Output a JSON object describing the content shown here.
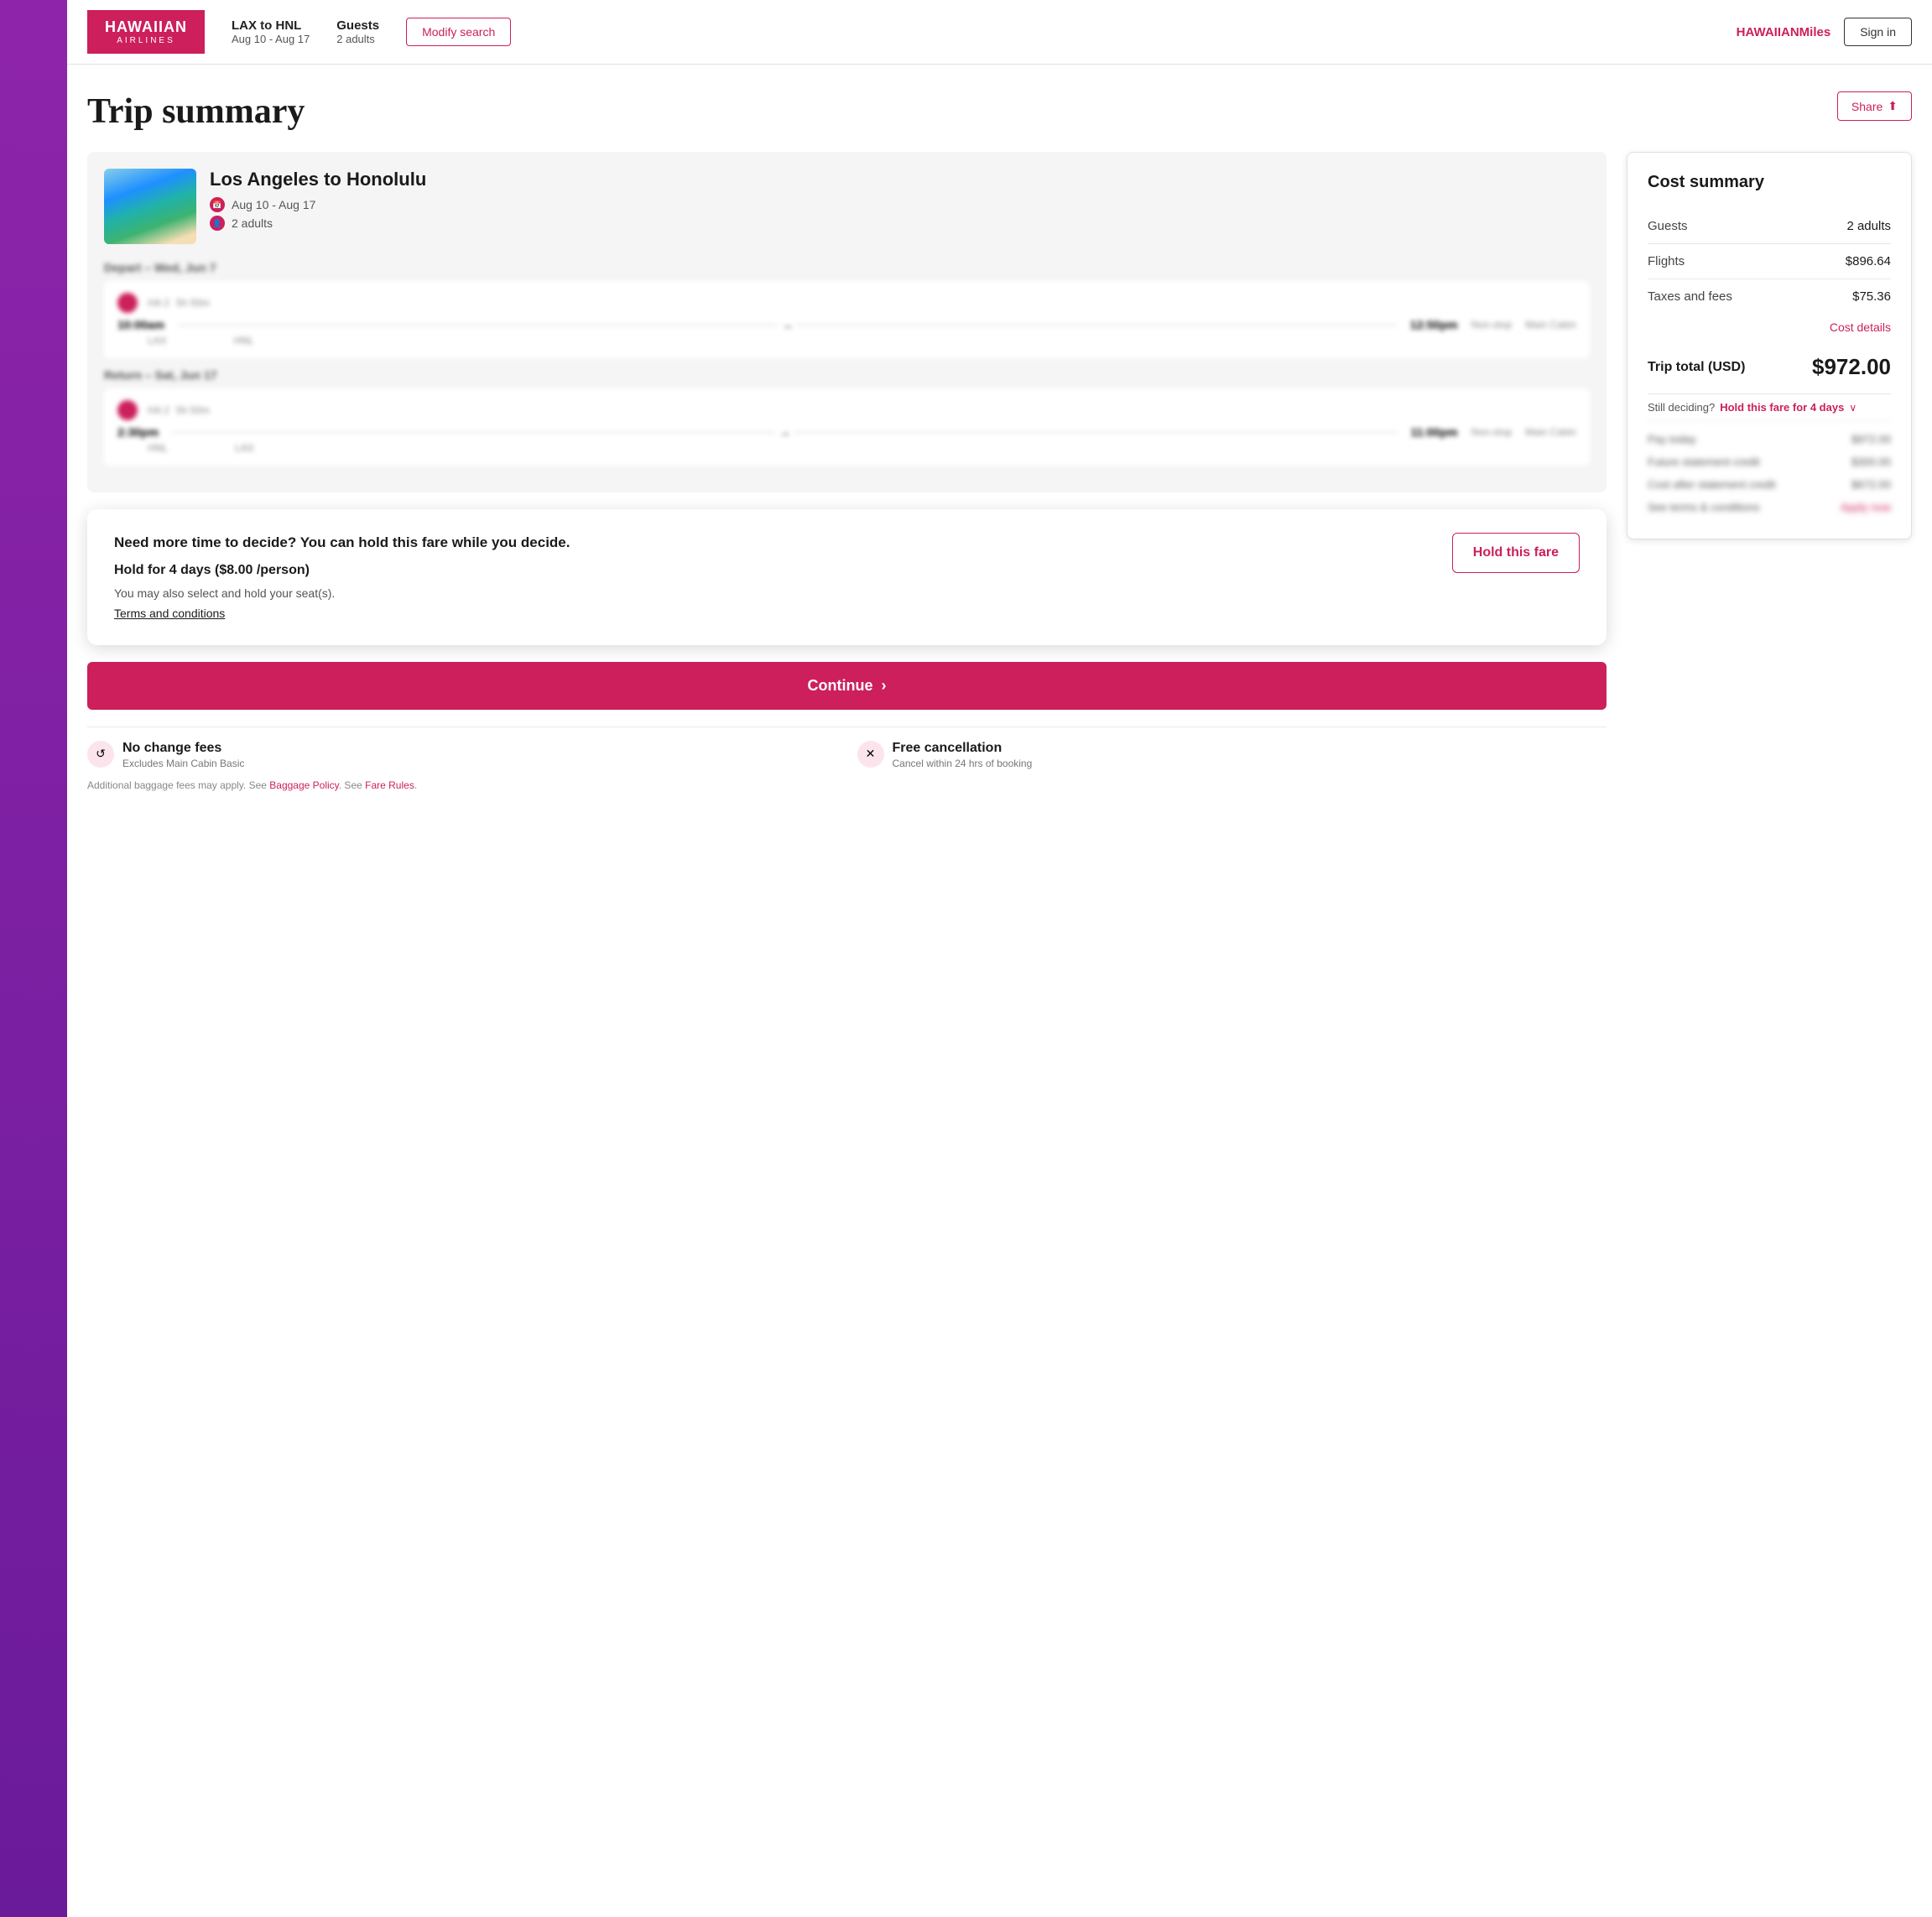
{
  "header": {
    "logo_main": "HAWAIIAN",
    "logo_sub": "AIRLINES",
    "route": "LAX to HNL",
    "dates": "Aug 10 - Aug 17",
    "guests_label": "Guests",
    "guests_value": "2 adults",
    "modify_btn": "Modify search",
    "miles_prefix": "HAWAIIAN",
    "miles_suffix": "Miles",
    "signin_btn": "Sign in"
  },
  "page": {
    "title": "Trip summary",
    "share_btn": "Share"
  },
  "trip_card": {
    "route_title": "Los Angeles to Honolulu",
    "dates": "Aug 10 - Aug 17",
    "guests": "2 adults",
    "depart_header": "Depart – Wed, Jun 7",
    "depart_flight": {
      "flight_num": "HA 2",
      "duration": "5h 50m",
      "depart_time": "10:00am",
      "arrive_time": "12:50pm",
      "stop": "Non-stop",
      "cabin": "Main Cabin",
      "from_airport": "LAX",
      "to_airport": "HNL"
    },
    "return_header": "Return – Sat, Jun 17",
    "return_flight": {
      "flight_num": "HA 2",
      "duration": "5h 50m",
      "depart_time": "2:30pm",
      "arrive_time": "11:00pm",
      "stop": "Non-stop",
      "cabin": "Main Cabin",
      "from_airport": "HNL",
      "to_airport": "LAX"
    }
  },
  "cost_summary": {
    "title": "Cost summary",
    "guests_label": "Guests",
    "guests_value": "2 adults",
    "flights_label": "Flights",
    "flights_value": "$896.64",
    "taxes_label": "Taxes and fees",
    "taxes_value": "$75.36",
    "cost_details_link": "Cost details",
    "total_label": "Trip total (USD)",
    "total_value": "$972.00",
    "deciding_text": "Still deciding?",
    "hold_fare_link": "Hold this fare for 4 days",
    "breakdown": {
      "pay_today_label": "Pay today",
      "pay_today_value": "$972.00",
      "future_credit_label": "Future statement credit",
      "future_credit_value": "$300.00",
      "after_credit_label": "Cost after statement credit",
      "after_credit_value": "$672.00",
      "terms_label": "See terms & conditions",
      "apply_now": "Apply now"
    }
  },
  "hold_popup": {
    "heading": "Need more time to decide? You can hold this fare while you decide.",
    "duration": "Hold for 4 days ($8.00 /person)",
    "subtext": "You may also select and hold your seat(s).",
    "terms_link": "Terms and conditions",
    "button": "Hold this fare"
  },
  "continue_btn": "Continue",
  "benefits": [
    {
      "icon": "↺",
      "title": "No change fees",
      "sub": "Excludes Main Cabin Basic"
    },
    {
      "icon": "✕",
      "title": "Free cancellation",
      "sub": "Cancel within 24 hrs of booking"
    }
  ],
  "footnote": "Additional baggage fees may apply. See Baggage Policy. See Fare Rules."
}
